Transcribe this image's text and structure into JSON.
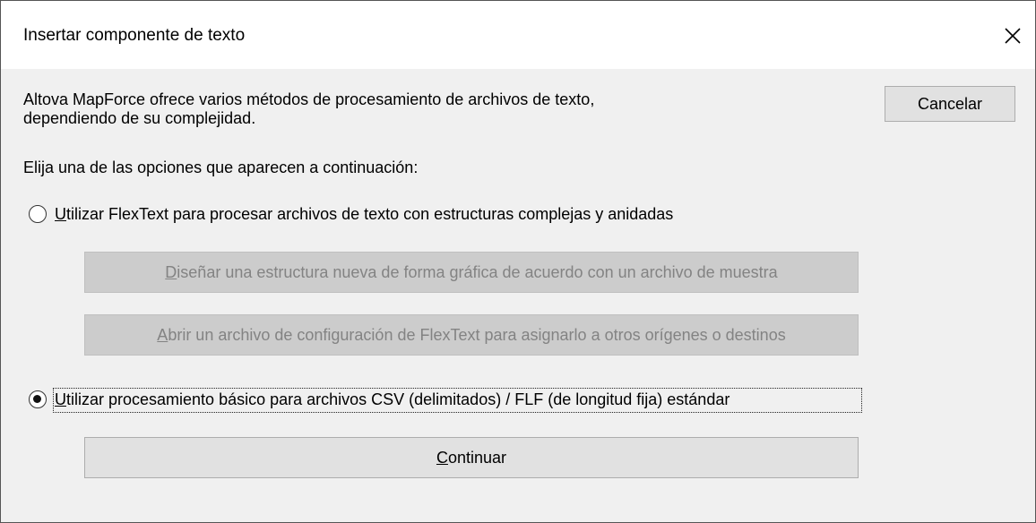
{
  "dialog": {
    "title": "Insertar componente de texto",
    "intro_line1": "Altova MapForce ofrece varios métodos de procesamiento de archivos de texto,",
    "intro_line2": "dependiendo de su complejidad.",
    "choose_prompt": "Elija una de las opciones que aparecen a continuación:",
    "cancel_label": "Cancelar",
    "option_flextext": {
      "mnemonic": "U",
      "label_rest": "tilizar FlexText para procesar archivos de texto con estructuras complejas y anidadas",
      "selected": false,
      "design_button": {
        "mnemonic": "D",
        "rest": "iseñar una estructura nueva de forma gráfica de acuerdo con un archivo de muestra",
        "enabled": false
      },
      "open_button": {
        "mnemonic": "A",
        "rest": "brir un archivo de configuración de FlexText para asignarlo a otros orígenes o destinos",
        "enabled": false
      }
    },
    "option_basic": {
      "mnemonic": "U",
      "label_rest": "tilizar procesamiento básico para archivos CSV (delimitados) / FLF (de longitud fija) estándar",
      "selected": true,
      "continue_button": {
        "mnemonic": "C",
        "rest": "ontinuar",
        "enabled": true
      }
    }
  }
}
